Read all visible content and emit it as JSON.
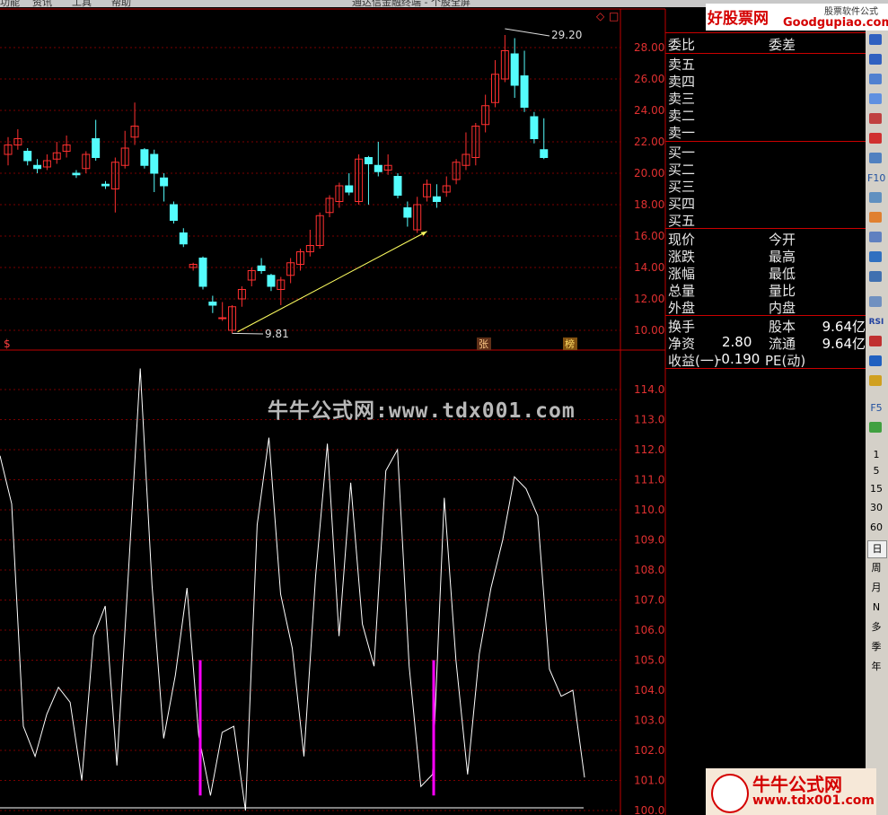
{
  "top_menu": [
    "功能",
    "资讯",
    "工具",
    "帮助"
  ],
  "window_title": "通达信金融终端 - 个股全屏",
  "chart_data": {
    "type": "candlestick",
    "price_axis": [
      "28.00",
      "26.00",
      "24.00",
      "22.00",
      "20.00",
      "18.00",
      "16.00",
      "14.00",
      "12.00",
      "10.00"
    ],
    "high_label": "29.20",
    "low_label": "9.81",
    "markers": [
      "$",
      "张",
      "榜"
    ],
    "candles": [
      [
        21.2,
        21.8,
        20.5,
        22.3
      ],
      [
        21.8,
        22.2,
        21.5,
        22.8
      ],
      [
        21.4,
        20.8,
        20.5,
        21.6
      ],
      [
        20.5,
        20.3,
        20.0,
        20.9
      ],
      [
        20.4,
        20.8,
        20.2,
        21.2
      ],
      [
        20.9,
        21.3,
        20.6,
        22.0
      ],
      [
        21.4,
        21.8,
        21.0,
        22.4
      ],
      [
        20.0,
        19.9,
        19.7,
        20.2
      ],
      [
        20.3,
        21.2,
        20.0,
        21.4
      ],
      [
        22.2,
        21.0,
        20.8,
        23.4
      ],
      [
        19.3,
        19.2,
        19.0,
        19.5
      ],
      [
        19.0,
        20.7,
        17.5,
        21.0
      ],
      [
        20.5,
        21.6,
        20.3,
        22.7
      ],
      [
        22.3,
        23.0,
        21.8,
        24.5
      ],
      [
        21.5,
        20.5,
        20.3,
        21.6
      ],
      [
        21.2,
        20.0,
        18.8,
        21.5
      ],
      [
        19.7,
        19.2,
        18.2,
        20.0
      ],
      [
        18.0,
        17.0,
        16.8,
        18.2
      ],
      [
        16.2,
        15.5,
        15.3,
        16.5
      ],
      [
        14.0,
        14.2,
        13.8,
        14.3
      ],
      [
        14.6,
        12.8,
        12.6,
        14.7
      ],
      [
        11.8,
        11.6,
        11.1,
        12.2
      ],
      [
        10.8,
        10.8,
        10.6,
        11.8
      ],
      [
        10.0,
        11.5,
        9.81,
        11.6
      ],
      [
        12.0,
        12.6,
        11.5,
        12.8
      ],
      [
        13.2,
        13.8,
        12.8,
        14.0
      ],
      [
        14.1,
        13.8,
        13.6,
        14.6
      ],
      [
        13.5,
        12.8,
        12.5,
        13.6
      ],
      [
        12.6,
        13.2,
        11.6,
        13.4
      ],
      [
        13.5,
        14.3,
        13.0,
        14.6
      ],
      [
        14.2,
        15.0,
        13.8,
        15.2
      ],
      [
        15.0,
        15.4,
        14.7,
        16.4
      ],
      [
        15.4,
        17.3,
        15.2,
        17.5
      ],
      [
        17.5,
        18.4,
        17.2,
        18.6
      ],
      [
        18.2,
        19.2,
        17.8,
        19.4
      ],
      [
        19.2,
        18.8,
        18.6,
        20.0
      ],
      [
        18.2,
        20.9,
        18.0,
        21.2
      ],
      [
        21.0,
        20.6,
        18.0,
        21.1
      ],
      [
        20.5,
        20.1,
        19.8,
        22.0
      ],
      [
        20.2,
        20.5,
        19.9,
        21.2
      ],
      [
        19.8,
        18.6,
        18.4,
        20.0
      ],
      [
        17.8,
        17.2,
        16.6,
        18.2
      ],
      [
        16.4,
        18.0,
        16.2,
        18.5
      ],
      [
        18.5,
        19.3,
        18.2,
        19.6
      ],
      [
        18.5,
        18.2,
        17.8,
        19.3
      ],
      [
        18.8,
        19.2,
        18.5,
        19.8
      ],
      [
        19.6,
        20.7,
        19.3,
        20.9
      ],
      [
        20.5,
        21.2,
        20.2,
        22.6
      ],
      [
        21.0,
        23.0,
        20.5,
        23.2
      ],
      [
        23.1,
        24.3,
        22.6,
        25.0
      ],
      [
        24.5,
        26.3,
        24.2,
        27.2
      ],
      [
        26.0,
        27.8,
        25.8,
        28.8
      ],
      [
        27.6,
        25.6,
        24.8,
        28.6
      ],
      [
        26.2,
        24.2,
        23.9,
        27.8
      ],
      [
        23.6,
        22.2,
        21.9,
        23.9
      ],
      [
        21.5,
        21.0,
        20.9,
        23.5
      ]
    ],
    "indicator_axis": [
      "114.0",
      "113.0",
      "112.0",
      "111.0",
      "110.0",
      "109.0",
      "108.0",
      "107.0",
      "106.0",
      "105.0",
      "104.0",
      "103.0",
      "102.0",
      "101.0",
      "100.0"
    ],
    "indicator_line": [
      111.8,
      110.2,
      102.8,
      101.8,
      103.2,
      104.1,
      103.6,
      101.0,
      105.8,
      106.8,
      101.5,
      108.0,
      114.7,
      107.5,
      102.4,
      104.5,
      107.4,
      102.5,
      100.5,
      102.6,
      102.8,
      100.0,
      109.5,
      112.4,
      107.2,
      105.4,
      101.8,
      107.8,
      112.2,
      105.8,
      110.9,
      106.2,
      104.8,
      111.3,
      112.0,
      104.8,
      100.8,
      101.2,
      110.4,
      105.0,
      101.2,
      105.2,
      107.4,
      109.0,
      111.1,
      110.7,
      109.8,
      104.7,
      103.8,
      104.0,
      101.1
    ],
    "signals": [
      {
        "index": 18,
        "top": 105.0,
        "bottom": 100.5
      },
      {
        "index": 40,
        "top": 105.0,
        "bottom": 100.5
      }
    ]
  },
  "quote_panel": {
    "weibi_label": "委比",
    "weicha_label": "委差",
    "sell": [
      "卖五",
      "卖四",
      "卖三",
      "卖二",
      "卖一"
    ],
    "buy": [
      "买一",
      "买二",
      "买三",
      "买四",
      "买五"
    ],
    "stats_left": [
      "现价",
      "涨跌",
      "涨幅",
      "总量",
      "外盘"
    ],
    "stats_right": [
      "今开",
      "最高",
      "最低",
      "量比",
      "内盘"
    ],
    "turnover_label": "换手",
    "shares_label": "股本",
    "shares_value": "9.64亿",
    "netasset_label": "净资",
    "netasset_value": "2.80",
    "float_label": "流通",
    "float_value": "9.64亿",
    "eps_label": "收益(一)",
    "eps_value": "-0.190",
    "pe_label": "PE(动)"
  },
  "toolbar": {
    "periods": [
      "1",
      "5",
      "15",
      "30",
      "60",
      "日",
      "周",
      "月",
      "N",
      "多",
      "季",
      "年"
    ],
    "labels": [
      "F10",
      "F5",
      "RSI"
    ]
  },
  "logo": {
    "brand": "好股票网",
    "domain": "Goodgupiao.com",
    "tagline": "股票软件公式"
  },
  "watermark": "牛牛公式网:www.tdx001.com",
  "badge": {
    "name": "牛牛公式网",
    "url": "www.tdx001.com"
  },
  "colors": {
    "up": "#ff3030",
    "down": "#54fcfc",
    "axis": "#c00000",
    "line": "#ffffff",
    "signal": "#ff00ff"
  }
}
